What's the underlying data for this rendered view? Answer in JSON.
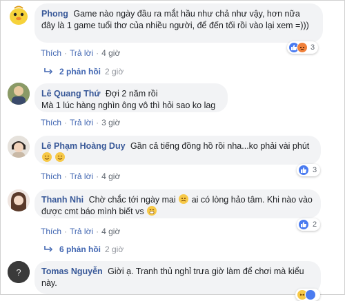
{
  "comments": [
    {
      "name": "Phong",
      "text": "Game nào ngày đầu ra mắt hầu như chả như vậy, hơn nữa đây là 1 game tuổi thơ của nhiều người, để đến tối rồi vào lại xem =)))",
      "like": "Thích",
      "reply": "Trả lời",
      "time": "4 giờ",
      "reaction_count": "3",
      "replies": {
        "label": "2 phản hồi",
        "time": "2 giờ"
      }
    },
    {
      "name": "Lê Quang Thứ",
      "text": "Đợi 2 năm rồi Mà 1 lúc hàng nghìn ông vô thì hỏi sao ko lag",
      "text_line1": "Đợi 2 năm rồi",
      "text_line2": "Mà 1 lúc hàng nghìn ông vô thì hỏi sao ko lag",
      "like": "Thích",
      "reply": "Trả lời",
      "time": "3 giờ"
    },
    {
      "name": "Lê Phạm Hoàng Duy",
      "text": "Gần cả tiếng đồng hồ rồi nha...ko phải vài phút",
      "like": "Thích",
      "reply": "Trả lời",
      "time": "4 giờ",
      "reaction_count": "3"
    },
    {
      "name": "Thanh Nhi",
      "text_a": "Chờ chắc tới ngày mai",
      "text_b": "ai có lòng hảo tâm. Khi nào vào được cmt báo mình biết vs",
      "like": "Thích",
      "reply": "Trả lời",
      "time": "4 giờ",
      "reaction_count": "2",
      "replies": {
        "label": "6 phản hồi",
        "time": "2 giờ"
      }
    },
    {
      "name": "Tomas Nguyễn",
      "text": "Giời ạ. Tranh thủ nghỉ trưa giờ làm để chơi mà kiểu này."
    }
  ]
}
